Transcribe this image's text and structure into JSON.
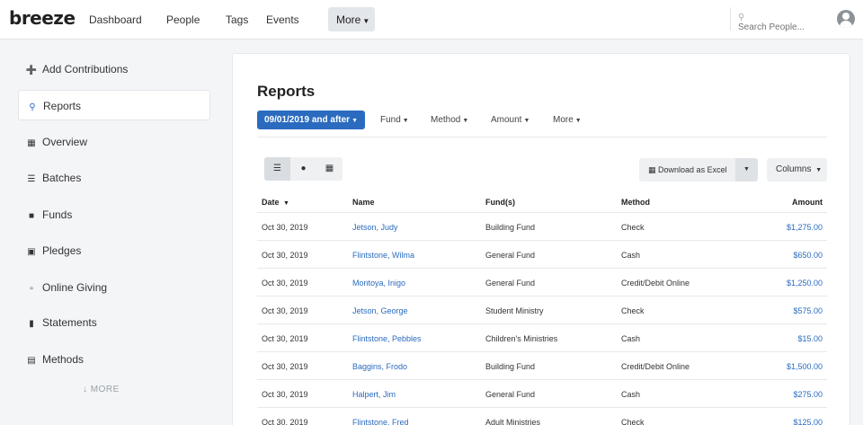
{
  "header": {
    "logo": "breeze",
    "nav": [
      {
        "label": "Dashboard"
      },
      {
        "label": "People"
      },
      {
        "label": "Tags"
      },
      {
        "label": "Events"
      }
    ],
    "more_label": "More",
    "search": {
      "placeholder": "Search People..."
    }
  },
  "sidebar": {
    "items": [
      {
        "label": "Add Contributions",
        "icon": "plus-circle-icon"
      },
      {
        "label": "Reports",
        "icon": "search-icon",
        "active": true
      },
      {
        "label": "Overview",
        "icon": "chart-icon"
      },
      {
        "label": "Batches",
        "icon": "list-icon"
      },
      {
        "label": "Funds",
        "icon": "box-icon"
      },
      {
        "label": "Pledges",
        "icon": "gift-icon"
      },
      {
        "label": "Online Giving",
        "icon": "laptop-icon"
      },
      {
        "label": "Statements",
        "icon": "file-icon"
      },
      {
        "label": "Methods",
        "icon": "credit-card-icon"
      }
    ],
    "more_label": "MORE"
  },
  "main": {
    "title": "Reports",
    "filters": {
      "date": "09/01/2019 and after",
      "fund": "Fund",
      "method": "Method",
      "amount": "Amount",
      "more": "More"
    },
    "download_label": "Download as Excel",
    "columns_label": "Columns",
    "table": {
      "headers": {
        "date": "Date",
        "name": "Name",
        "fund": "Fund(s)",
        "method": "Method",
        "amount": "Amount"
      },
      "rows": [
        {
          "date": "Oct 30, 2019",
          "name": "Jetson, Judy",
          "fund": "Building Fund",
          "method": "Check",
          "amount": "$1,275.00"
        },
        {
          "date": "Oct 30, 2019",
          "name": "Flintstone, Wilma",
          "fund": "General Fund",
          "method": "Cash",
          "amount": "$650.00"
        },
        {
          "date": "Oct 30, 2019",
          "name": "Montoya, Inigo",
          "fund": "General Fund",
          "method": "Credit/Debit Online",
          "amount": "$1,250.00"
        },
        {
          "date": "Oct 30, 2019",
          "name": "Jetson, George",
          "fund": "Student Ministry",
          "method": "Check",
          "amount": "$575.00"
        },
        {
          "date": "Oct 30, 2019",
          "name": "Flintstone, Pebbles",
          "fund": "Children's Ministries",
          "method": "Cash",
          "amount": "$15.00"
        },
        {
          "date": "Oct 30, 2019",
          "name": "Baggins, Frodo",
          "fund": "Building Fund",
          "method": "Credit/Debit Online",
          "amount": "$1,500.00"
        },
        {
          "date": "Oct 30, 2019",
          "name": "Halpert, Jim",
          "fund": "General Fund",
          "method": "Cash",
          "amount": "$275.00"
        },
        {
          "date": "Oct 30, 2019",
          "name": "Flintstone, Fred",
          "fund": "Adult Ministries",
          "method": "Check",
          "amount": "$125.00"
        }
      ]
    }
  },
  "colors": {
    "accent": "#2a6bbf",
    "background": "#f4f5f7"
  }
}
